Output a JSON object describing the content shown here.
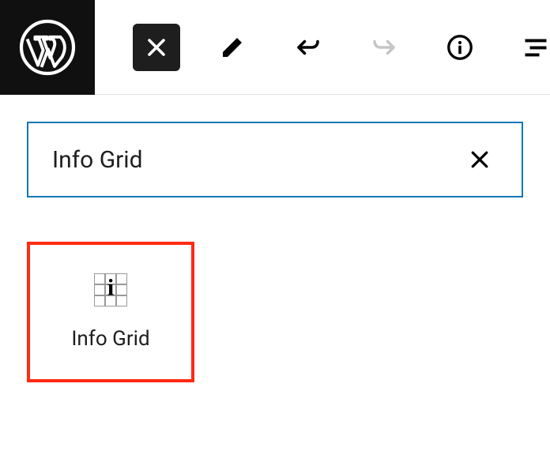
{
  "search": {
    "value": "Info Grid"
  },
  "blocks": [
    {
      "label": "Info Grid"
    }
  ],
  "icons": {
    "close": "close-icon",
    "edit": "edit-icon",
    "undo": "undo-icon",
    "redo": "redo-icon",
    "info": "info-icon",
    "outline": "outline-icon",
    "wordpress": "wordpress-logo",
    "clear": "clear-search-icon",
    "info_grid": "info-grid-block-icon"
  },
  "colors": {
    "toolbar_dark": "#1e1e1e",
    "search_border": "#0b78b8",
    "highlight_border": "#ff2a12",
    "disabled_icon": "#c0c0c0"
  }
}
